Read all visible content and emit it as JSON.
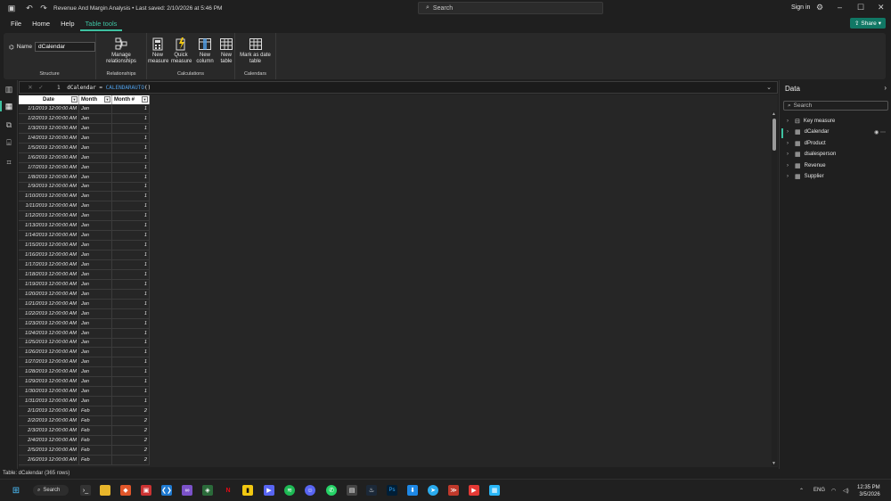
{
  "titlebar": {
    "title": "Revenue And Margin Analysis • Last saved: 2/10/2026 at 5:46 PM",
    "search_label": "Search",
    "signin_label": "Sign in"
  },
  "menubar": {
    "items": [
      "File",
      "Home",
      "Help",
      "Table tools"
    ],
    "share_label": "Share"
  },
  "ribbon": {
    "name_label": "Name",
    "name_value": "dCalendar",
    "structure_label": "Structure",
    "manage_relationships": "Manage relationships",
    "relationships_label": "Relationships",
    "new_measure": "New measure",
    "quick_measure": "Quick measure",
    "new_column": "New column",
    "new_table": "New table",
    "calculations_label": "Calculations",
    "mark_as_date_table": "Mark as date table",
    "calendars_label": "Calendars"
  },
  "formula": {
    "line_number": "1",
    "table_name": "dCalendar",
    "operator": "=",
    "function": "CALENDARAUTO",
    "args": "()"
  },
  "table": {
    "headers": [
      "Date",
      "Month",
      "Month #"
    ],
    "rows": [
      [
        "1/1/2019 12:00:00 AM",
        "Jan",
        "1"
      ],
      [
        "1/2/2019 12:00:00 AM",
        "Jan",
        "1"
      ],
      [
        "1/3/2019 12:00:00 AM",
        "Jan",
        "1"
      ],
      [
        "1/4/2019 12:00:00 AM",
        "Jan",
        "1"
      ],
      [
        "1/5/2019 12:00:00 AM",
        "Jan",
        "1"
      ],
      [
        "1/6/2019 12:00:00 AM",
        "Jan",
        "1"
      ],
      [
        "1/7/2019 12:00:00 AM",
        "Jan",
        "1"
      ],
      [
        "1/8/2019 12:00:00 AM",
        "Jan",
        "1"
      ],
      [
        "1/9/2019 12:00:00 AM",
        "Jan",
        "1"
      ],
      [
        "1/10/2019 12:00:00 AM",
        "Jan",
        "1"
      ],
      [
        "1/11/2019 12:00:00 AM",
        "Jan",
        "1"
      ],
      [
        "1/12/2019 12:00:00 AM",
        "Jan",
        "1"
      ],
      [
        "1/13/2019 12:00:00 AM",
        "Jan",
        "1"
      ],
      [
        "1/14/2019 12:00:00 AM",
        "Jan",
        "1"
      ],
      [
        "1/15/2019 12:00:00 AM",
        "Jan",
        "1"
      ],
      [
        "1/16/2019 12:00:00 AM",
        "Jan",
        "1"
      ],
      [
        "1/17/2019 12:00:00 AM",
        "Jan",
        "1"
      ],
      [
        "1/18/2019 12:00:00 AM",
        "Jan",
        "1"
      ],
      [
        "1/19/2019 12:00:00 AM",
        "Jan",
        "1"
      ],
      [
        "1/20/2019 12:00:00 AM",
        "Jan",
        "1"
      ],
      [
        "1/21/2019 12:00:00 AM",
        "Jan",
        "1"
      ],
      [
        "1/22/2019 12:00:00 AM",
        "Jan",
        "1"
      ],
      [
        "1/23/2019 12:00:00 AM",
        "Jan",
        "1"
      ],
      [
        "1/24/2019 12:00:00 AM",
        "Jan",
        "1"
      ],
      [
        "1/25/2019 12:00:00 AM",
        "Jan",
        "1"
      ],
      [
        "1/26/2019 12:00:00 AM",
        "Jan",
        "1"
      ],
      [
        "1/27/2019 12:00:00 AM",
        "Jan",
        "1"
      ],
      [
        "1/28/2019 12:00:00 AM",
        "Jan",
        "1"
      ],
      [
        "1/29/2019 12:00:00 AM",
        "Jan",
        "1"
      ],
      [
        "1/30/2019 12:00:00 AM",
        "Jan",
        "1"
      ],
      [
        "1/31/2019 12:00:00 AM",
        "Jan",
        "1"
      ],
      [
        "2/1/2019 12:00:00 AM",
        "Feb",
        "2"
      ],
      [
        "2/2/2019 12:00:00 AM",
        "Feb",
        "2"
      ],
      [
        "2/3/2019 12:00:00 AM",
        "Feb",
        "2"
      ],
      [
        "2/4/2019 12:00:00 AM",
        "Feb",
        "2"
      ],
      [
        "2/5/2019 12:00:00 AM",
        "Feb",
        "2"
      ],
      [
        "2/6/2019 12:00:00 AM",
        "Feb",
        "2"
      ]
    ]
  },
  "data_pane": {
    "title": "Data",
    "search_placeholder": "Search",
    "items": [
      "Key measure",
      "dCalendar",
      "dProduct",
      "dsalesperson",
      "Revenue",
      "Supplier"
    ]
  },
  "statusbar": {
    "text": "Table: dCalendar (365 rows)"
  },
  "taskbar": {
    "search_label": "Search",
    "lang": "ENG",
    "time": "12:35 PM",
    "date": "3/5/2026"
  },
  "colors": {
    "accent": "#3ec1a1",
    "share": "#117865",
    "powerbi_yellow": "#f2c811"
  }
}
